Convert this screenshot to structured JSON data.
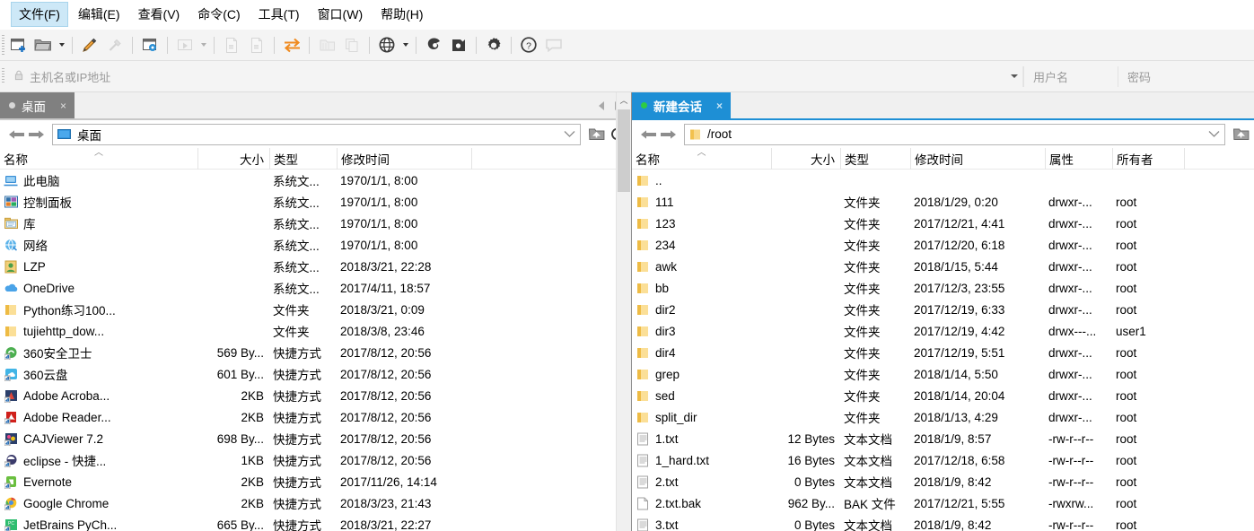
{
  "menubar": {
    "items": [
      {
        "label": "文件(F)",
        "active": true
      },
      {
        "label": "编辑(E)",
        "active": false
      },
      {
        "label": "查看(V)",
        "active": false
      },
      {
        "label": "命令(C)",
        "active": false
      },
      {
        "label": "工具(T)",
        "active": false
      },
      {
        "label": "窗口(W)",
        "active": false
      },
      {
        "label": "帮助(H)",
        "active": false
      }
    ]
  },
  "toolbar": {
    "buttons": [
      {
        "name": "new-file-transfer-icon",
        "enabled": true
      },
      {
        "name": "open-folder-icon",
        "enabled": true
      },
      {
        "name": "open-folder-dropdown-caret",
        "enabled": true
      },
      {
        "name": "edit-session-icon",
        "enabled": true
      },
      {
        "name": "connect-icon",
        "enabled": false
      },
      {
        "name": "session-properties-icon",
        "enabled": true
      },
      {
        "name": "run-script-icon",
        "enabled": false
      },
      {
        "name": "run-script-dropdown-caret",
        "enabled": false
      },
      {
        "name": "transfer-left-icon",
        "enabled": false
      },
      {
        "name": "transfer-right-icon",
        "enabled": false
      },
      {
        "name": "sync-transfer-icon",
        "enabled": true
      },
      {
        "name": "copy-folder-icon",
        "enabled": false
      },
      {
        "name": "paste-icon",
        "enabled": false
      },
      {
        "name": "globe-icon",
        "enabled": true
      },
      {
        "name": "globe-dropdown-caret",
        "enabled": true
      },
      {
        "name": "xshell-icon",
        "enabled": true
      },
      {
        "name": "xftp-icon",
        "enabled": true
      },
      {
        "name": "settings-gear-icon",
        "enabled": true
      },
      {
        "name": "help-icon",
        "enabled": true
      },
      {
        "name": "feedback-icon",
        "enabled": false
      }
    ]
  },
  "connectbar": {
    "host_placeholder": "主机名或IP地址",
    "host_value": "",
    "username_placeholder": "用户名",
    "username_value": "",
    "password_placeholder": "密码",
    "password_value": ""
  },
  "left_pane": {
    "tab": {
      "label": "桌面",
      "close": "×",
      "state": "inactive"
    },
    "address": {
      "value": "桌面",
      "icon": "desktop-icon"
    },
    "toolbar": {
      "up_folder": "up-folder-icon",
      "refresh": "refresh-icon"
    },
    "columns": [
      {
        "label": "名称",
        "align": "left",
        "sorted": true
      },
      {
        "label": "大小",
        "align": "right",
        "sorted": false
      },
      {
        "label": "类型",
        "align": "left",
        "sorted": false
      },
      {
        "label": "修改时间",
        "align": "left",
        "sorted": false
      }
    ],
    "rows": [
      {
        "icon": "computer-icon",
        "name": "此电脑",
        "size": "",
        "type": "系统文...",
        "mtime": "1970/1/1, 8:00"
      },
      {
        "icon": "control-panel-icon",
        "name": "控制面板",
        "size": "",
        "type": "系统文...",
        "mtime": "1970/1/1, 8:00"
      },
      {
        "icon": "library-icon",
        "name": "库",
        "size": "",
        "type": "系统文...",
        "mtime": "1970/1/1, 8:00"
      },
      {
        "icon": "network-icon",
        "name": "网络",
        "size": "",
        "type": "系统文...",
        "mtime": "1970/1/1, 8:00"
      },
      {
        "icon": "user-icon",
        "name": "LZP",
        "size": "",
        "type": "系统文...",
        "mtime": "2018/3/21, 22:28"
      },
      {
        "icon": "onedrive-icon",
        "name": "OneDrive",
        "size": "",
        "type": "系统文...",
        "mtime": "2017/4/11, 18:57"
      },
      {
        "icon": "folder-icon",
        "name": "Python练习100...",
        "size": "",
        "type": "文件夹",
        "mtime": "2018/3/21, 0:09"
      },
      {
        "icon": "folder-icon",
        "name": "tujiehttp_dow...",
        "size": "",
        "type": "文件夹",
        "mtime": "2018/3/8, 23:46"
      },
      {
        "icon": "shortcut-360-icon",
        "name": "360安全卫士",
        "size": "569 By...",
        "type": "快捷方式",
        "mtime": "2017/8/12, 20:56"
      },
      {
        "icon": "shortcut-360cloud-icon",
        "name": "360云盘",
        "size": "601 By...",
        "type": "快捷方式",
        "mtime": "2017/8/12, 20:56"
      },
      {
        "icon": "shortcut-acrobat-icon",
        "name": "Adobe Acroba...",
        "size": "2KB",
        "type": "快捷方式",
        "mtime": "2017/8/12, 20:56"
      },
      {
        "icon": "shortcut-reader-icon",
        "name": "Adobe Reader...",
        "size": "2KB",
        "type": "快捷方式",
        "mtime": "2017/8/12, 20:56"
      },
      {
        "icon": "shortcut-caj-icon",
        "name": "CAJViewer 7.2",
        "size": "698 By...",
        "type": "快捷方式",
        "mtime": "2017/8/12, 20:56"
      },
      {
        "icon": "shortcut-eclipse-icon",
        "name": "eclipse - 快捷...",
        "size": "1KB",
        "type": "快捷方式",
        "mtime": "2017/8/12, 20:56"
      },
      {
        "icon": "shortcut-evernote-icon",
        "name": "Evernote",
        "size": "2KB",
        "type": "快捷方式",
        "mtime": "2017/11/26, 14:14"
      },
      {
        "icon": "shortcut-chrome-icon",
        "name": "Google Chrome",
        "size": "2KB",
        "type": "快捷方式",
        "mtime": "2018/3/23, 21:43"
      },
      {
        "icon": "shortcut-pycharm-icon",
        "name": "JetBrains PyCh...",
        "size": "665 By...",
        "type": "快捷方式",
        "mtime": "2018/3/21, 22:27"
      }
    ]
  },
  "right_pane": {
    "tab": {
      "label": "新建会话",
      "close": "×",
      "state": "active"
    },
    "address": {
      "value": "/root",
      "icon": "folder-icon"
    },
    "toolbar": {
      "up_folder": "up-folder-icon"
    },
    "columns": [
      {
        "label": "名称",
        "align": "left",
        "sorted": true
      },
      {
        "label": "大小",
        "align": "right",
        "sorted": false
      },
      {
        "label": "类型",
        "align": "left",
        "sorted": false
      },
      {
        "label": "修改时间",
        "align": "left",
        "sorted": false
      },
      {
        "label": "属性",
        "align": "left",
        "sorted": false
      },
      {
        "label": "所有者",
        "align": "left",
        "sorted": false
      }
    ],
    "rows": [
      {
        "icon": "folder-icon",
        "name": "..",
        "size": "",
        "type": "",
        "mtime": "",
        "attrs": "",
        "owner": ""
      },
      {
        "icon": "folder-icon",
        "name": "111",
        "size": "",
        "type": "文件夹",
        "mtime": "2018/1/29, 0:20",
        "attrs": "drwxr-...",
        "owner": "root"
      },
      {
        "icon": "folder-icon",
        "name": "123",
        "size": "",
        "type": "文件夹",
        "mtime": "2017/12/21, 4:41",
        "attrs": "drwxr-...",
        "owner": "root"
      },
      {
        "icon": "folder-icon",
        "name": "234",
        "size": "",
        "type": "文件夹",
        "mtime": "2017/12/20, 6:18",
        "attrs": "drwxr-...",
        "owner": "root"
      },
      {
        "icon": "folder-icon",
        "name": "awk",
        "size": "",
        "type": "文件夹",
        "mtime": "2018/1/15, 5:44",
        "attrs": "drwxr-...",
        "owner": "root"
      },
      {
        "icon": "folder-icon",
        "name": "bb",
        "size": "",
        "type": "文件夹",
        "mtime": "2017/12/3, 23:55",
        "attrs": "drwxr-...",
        "owner": "root"
      },
      {
        "icon": "folder-icon",
        "name": "dir2",
        "size": "",
        "type": "文件夹",
        "mtime": "2017/12/19, 6:33",
        "attrs": "drwxr-...",
        "owner": "root"
      },
      {
        "icon": "folder-icon",
        "name": "dir3",
        "size": "",
        "type": "文件夹",
        "mtime": "2017/12/19, 4:42",
        "attrs": "drwx---...",
        "owner": "user1"
      },
      {
        "icon": "folder-icon",
        "name": "dir4",
        "size": "",
        "type": "文件夹",
        "mtime": "2017/12/19, 5:51",
        "attrs": "drwxr-...",
        "owner": "root"
      },
      {
        "icon": "folder-icon",
        "name": "grep",
        "size": "",
        "type": "文件夹",
        "mtime": "2018/1/14, 5:50",
        "attrs": "drwxr-...",
        "owner": "root"
      },
      {
        "icon": "folder-icon",
        "name": "sed",
        "size": "",
        "type": "文件夹",
        "mtime": "2018/1/14, 20:04",
        "attrs": "drwxr-...",
        "owner": "root"
      },
      {
        "icon": "folder-icon",
        "name": "split_dir",
        "size": "",
        "type": "文件夹",
        "mtime": "2018/1/13, 4:29",
        "attrs": "drwxr-...",
        "owner": "root"
      },
      {
        "icon": "text-file-icon",
        "name": "1.txt",
        "size": "12 Bytes",
        "type": "文本文档",
        "mtime": "2018/1/9, 8:57",
        "attrs": "-rw-r--r--",
        "owner": "root"
      },
      {
        "icon": "text-file-icon",
        "name": "1_hard.txt",
        "size": "16 Bytes",
        "type": "文本文档",
        "mtime": "2017/12/18, 6:58",
        "attrs": "-rw-r--r--",
        "owner": "root"
      },
      {
        "icon": "text-file-icon",
        "name": "2.txt",
        "size": "0 Bytes",
        "type": "文本文档",
        "mtime": "2018/1/9, 8:42",
        "attrs": "-rw-r--r--",
        "owner": "root"
      },
      {
        "icon": "blank-file-icon",
        "name": "2.txt.bak",
        "size": "962 By...",
        "type": "BAK 文件",
        "mtime": "2017/12/21, 5:55",
        "attrs": "-rwxrw...",
        "owner": "root"
      },
      {
        "icon": "text-file-icon",
        "name": "3.txt",
        "size": "0 Bytes",
        "type": "文本文档",
        "mtime": "2018/1/9, 8:42",
        "attrs": "-rw-r--r--",
        "owner": "root"
      }
    ]
  },
  "colors": {
    "accent": "#1e8fd5",
    "tab_inactive": "#808080",
    "toolbar_bg": "#f4f4f4",
    "menu_active": "#cde8f7",
    "folder_yellow": "#f7cd6a",
    "status_green": "#2ecc44"
  }
}
